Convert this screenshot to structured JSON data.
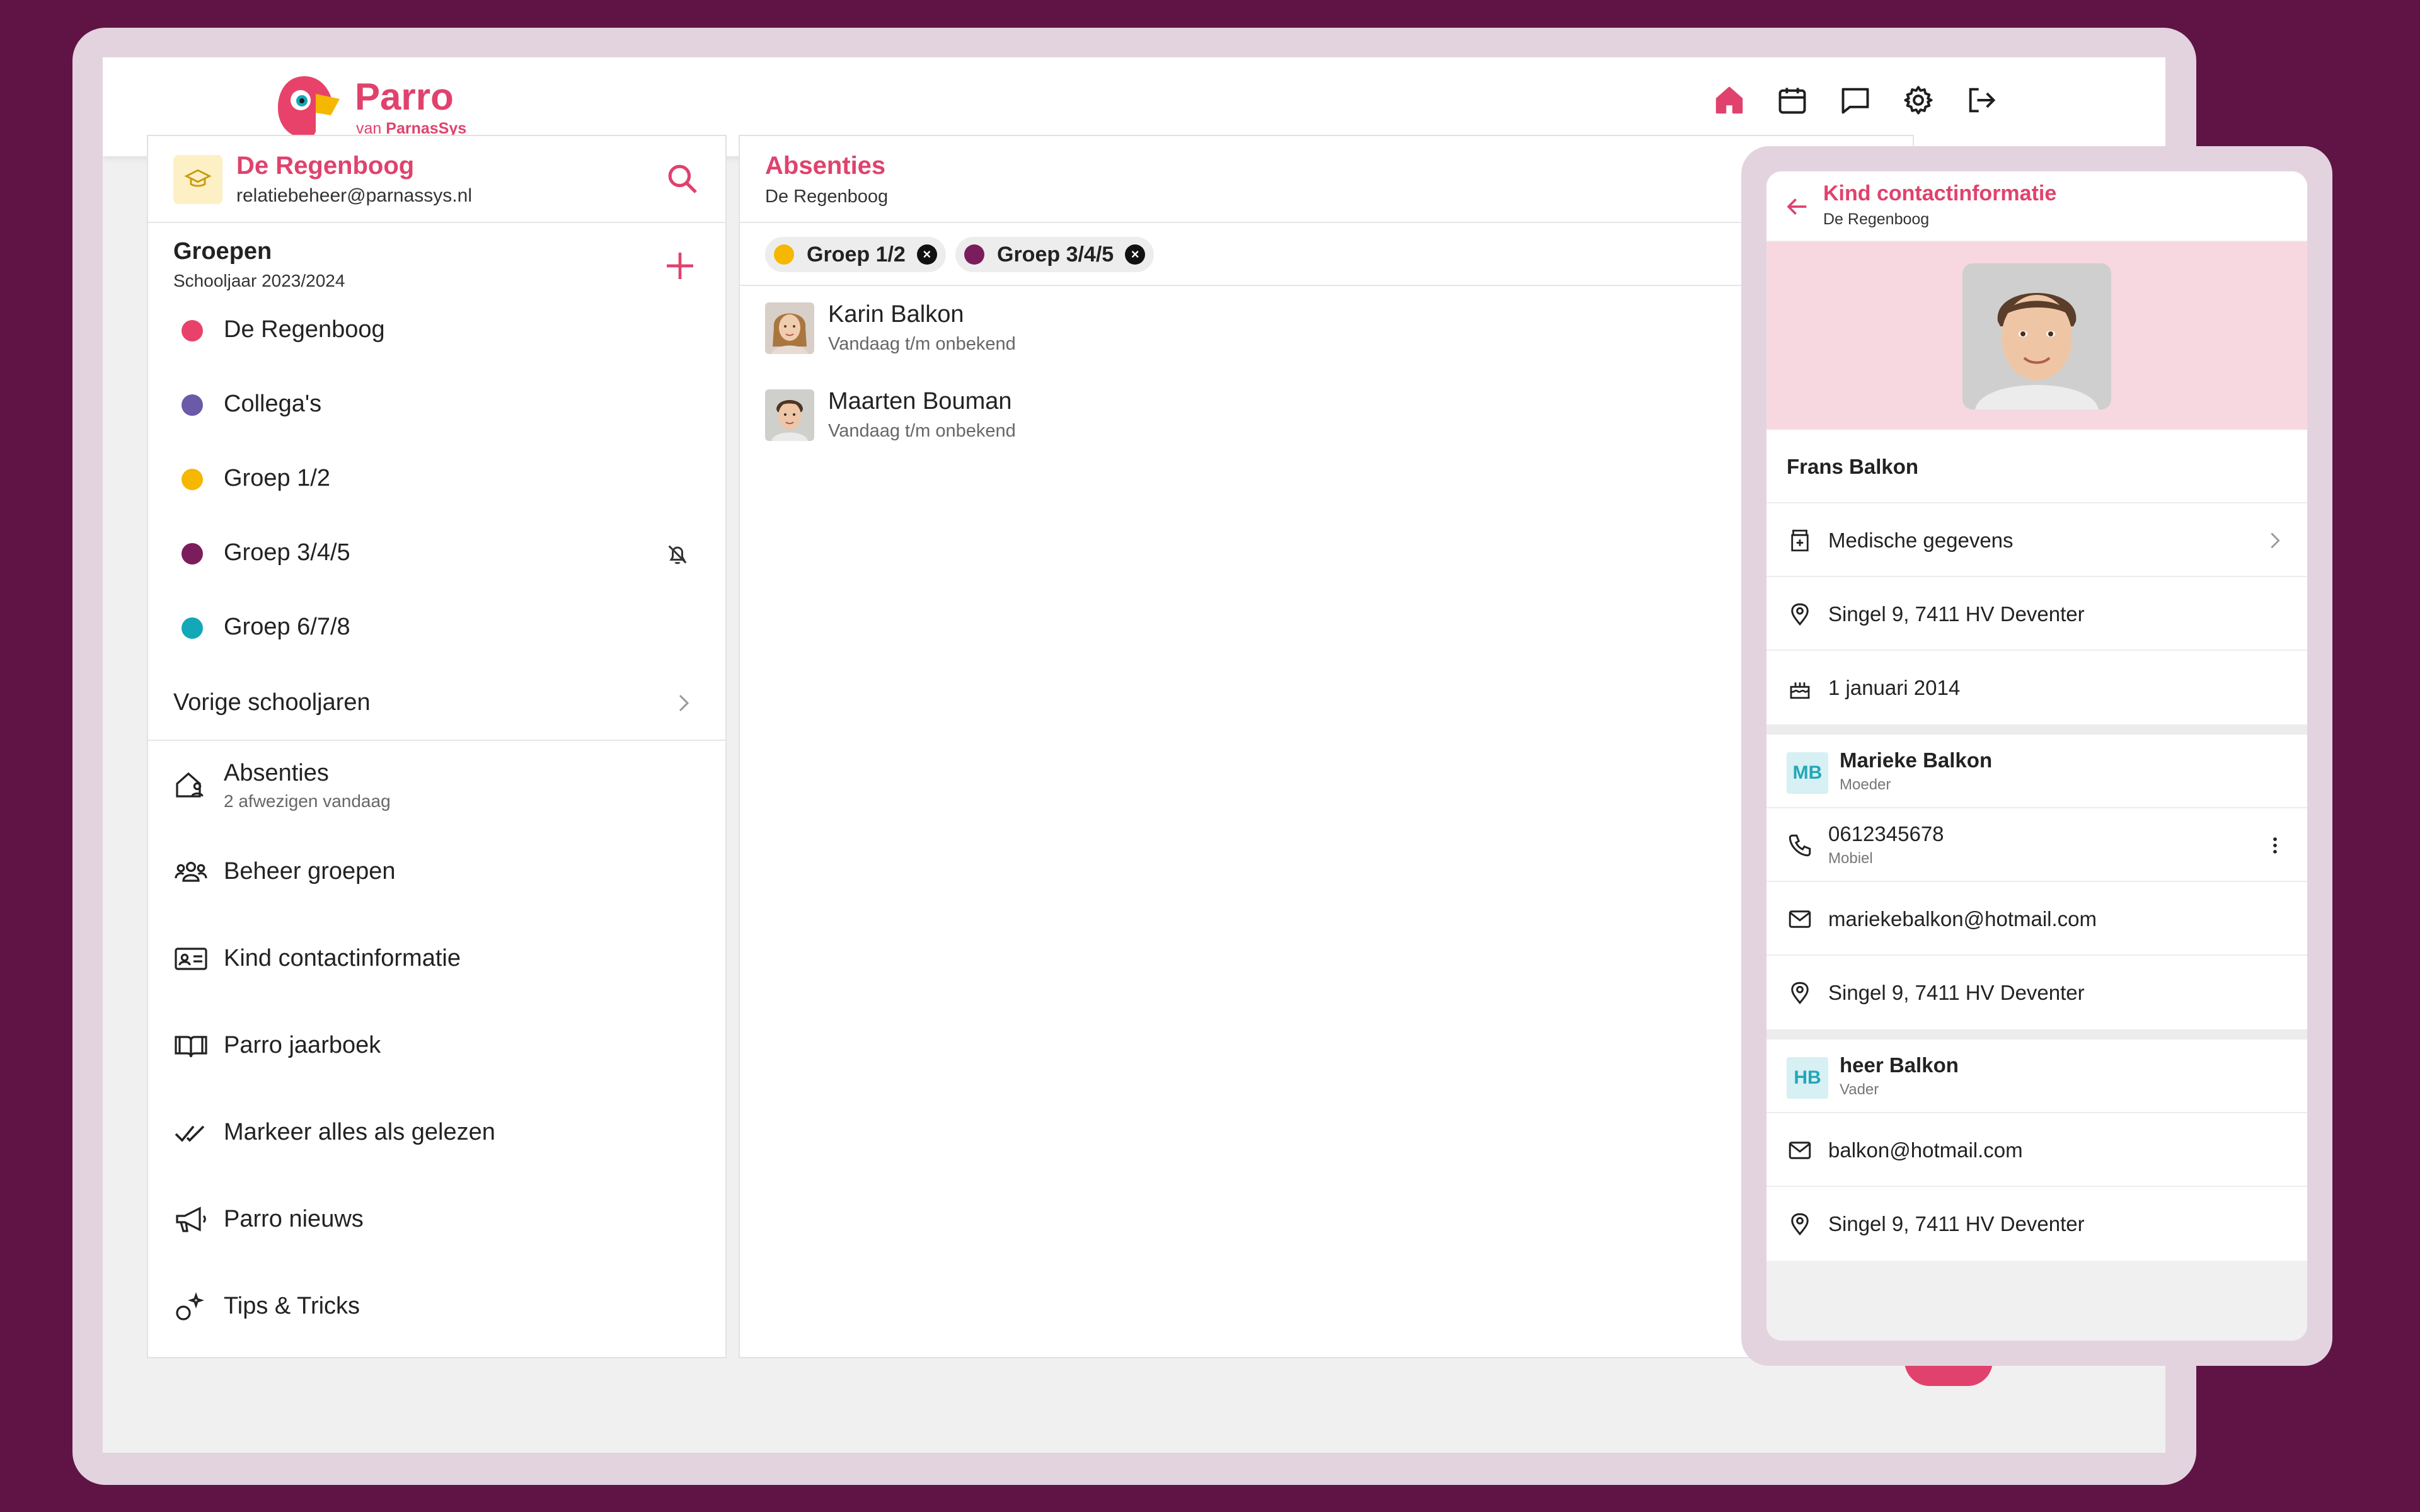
{
  "brand": {
    "name": "Parro",
    "sub_prefix": "van",
    "sub_name": "ParnasSys"
  },
  "header": {
    "icons": [
      "home-icon",
      "calendar-icon",
      "chat-icon",
      "settings-icon",
      "logout-icon"
    ],
    "active": "home-icon"
  },
  "school": {
    "name": "De Regenboog",
    "email": "relatiebeheer@parnassys.nl"
  },
  "groups": {
    "title": "Groepen",
    "subtitle": "Schooljaar 2023/2024",
    "items": [
      {
        "label": "De Regenboog",
        "color": "#e8426b",
        "muted": false
      },
      {
        "label": "Collega's",
        "color": "#6a5aa8",
        "muted": false
      },
      {
        "label": "Groep 1/2",
        "color": "#f5b700",
        "muted": false
      },
      {
        "label": "Groep 3/4/5",
        "color": "#7b1d5c",
        "muted": true
      },
      {
        "label": "Groep 6/7/8",
        "color": "#13a8b8",
        "muted": false
      }
    ],
    "previous_years": "Vorige schooljaren"
  },
  "menu": [
    {
      "label": "Absenties",
      "sub": "2 afwezigen vandaag",
      "icon": "house-person-icon"
    },
    {
      "label": "Beheer groepen",
      "icon": "people-icon"
    },
    {
      "label": "Kind contactinformatie",
      "icon": "id-card-icon"
    },
    {
      "label": "Parro jaarboek",
      "icon": "book-icon"
    },
    {
      "label": "Markeer alles als gelezen",
      "icon": "double-check-icon"
    },
    {
      "label": "Parro nieuws",
      "icon": "megaphone-icon"
    },
    {
      "label": "Tips & Tricks",
      "icon": "sparkle-icon"
    }
  ],
  "absences": {
    "title": "Absenties",
    "subtitle": "De Regenboog",
    "filters": [
      {
        "label": "Groep 1/2",
        "color": "#f5b700"
      },
      {
        "label": "Groep 3/4/5",
        "color": "#7b1d5c"
      }
    ],
    "people": [
      {
        "name": "Karin Balkon",
        "period": "Vandaag t/m onbekend"
      },
      {
        "name": "Maarten Bouman",
        "period": "Vandaag t/m onbekend"
      }
    ]
  },
  "contact_card": {
    "title": "Kind contactinformatie",
    "subtitle": "De Regenboog",
    "child_name": "Frans Balkon",
    "medical": "Medische gegevens",
    "address": "Singel 9, 7411 HV  Deventer",
    "birthday": "1 januari 2014",
    "mother": {
      "initials": "MB",
      "name": "Marieke Balkon",
      "role": "Moeder",
      "phone": "0612345678",
      "phone_type": "Mobiel",
      "email": "mariekebalkon@hotmail.com",
      "address": "Singel 9, 7411 HV  Deventer"
    },
    "father": {
      "initials": "HB",
      "name": "heer Balkon",
      "role": "Vader",
      "email": "balkon@hotmail.com",
      "address": "Singel 9, 7411 HV  Deventer"
    }
  },
  "colors": {
    "accent": "#e0426d",
    "background": "#5f1445",
    "frame": "#e3d3df"
  }
}
